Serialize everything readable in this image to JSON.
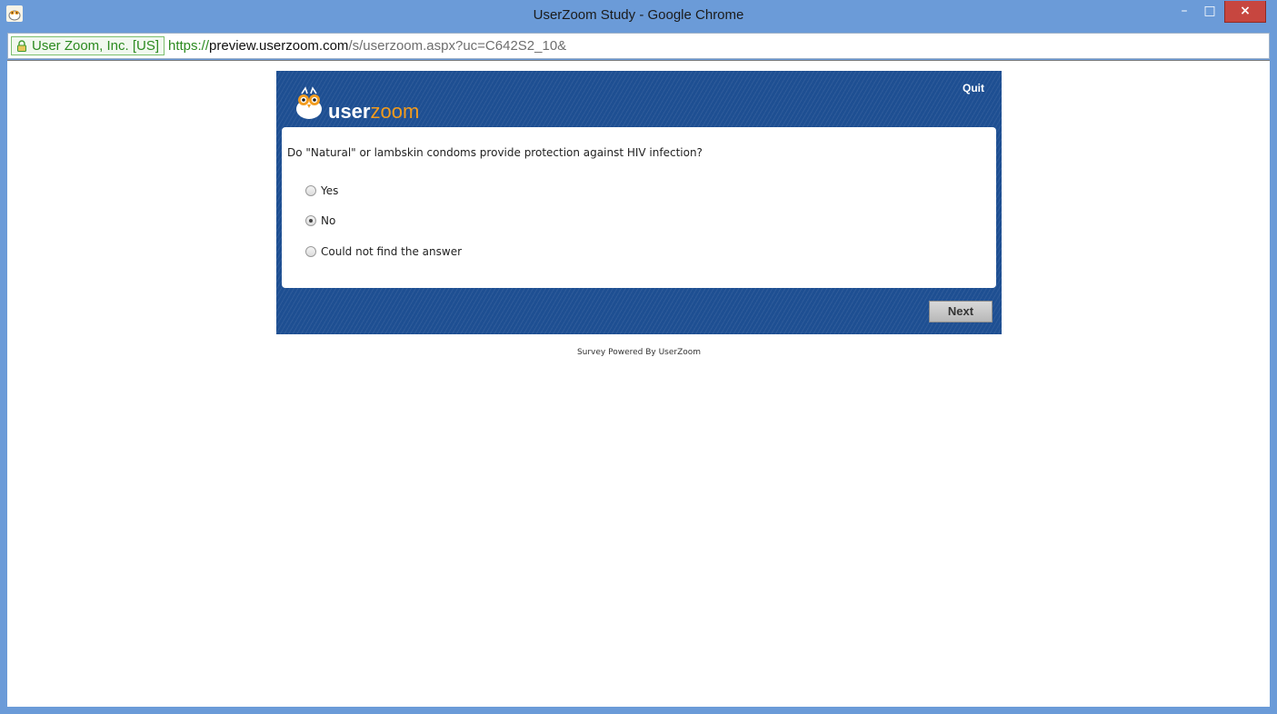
{
  "window": {
    "title": "UserZoom Study - Google Chrome",
    "minimize_label": "–",
    "maximize_label": "□",
    "close_label": "×",
    "icons": {
      "app": "owl-app-icon",
      "minimize": "minimize-icon",
      "maximize": "maximize-icon",
      "close": "close-icon"
    }
  },
  "address_bar": {
    "site_identity": "User Zoom, Inc. [US]",
    "url_scheme": "https://",
    "url_host": "preview.userzoom.com",
    "url_path": "/s/userzoom.aspx?uc=C642S2_10&",
    "lock_icon": "lock-icon"
  },
  "survey": {
    "brand": {
      "user": "user",
      "zoom": "zoom"
    },
    "quit_label": "Quit",
    "question": "Do \"Natural\" or lambskin condoms provide protection against HIV infection?",
    "options": [
      {
        "label": "Yes",
        "selected": false
      },
      {
        "label": "No",
        "selected": true
      },
      {
        "label": "Could not find the answer",
        "selected": false
      }
    ],
    "next_label": "Next",
    "footer": "Survey Powered By UserZoom"
  },
  "colors": {
    "titlebar": "#6b9bd8",
    "survey_background": "#1e4f92",
    "brand_orange": "#f29b1d",
    "secure_green": "#2b8a1f",
    "close_button": "#c7463f"
  }
}
